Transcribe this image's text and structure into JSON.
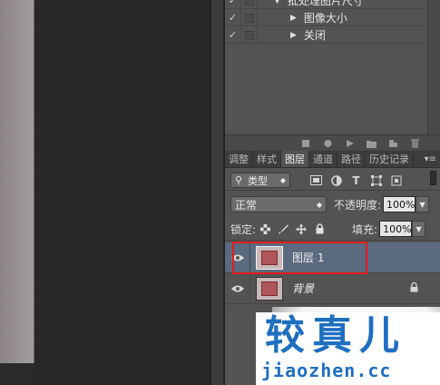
{
  "actions": {
    "items": [
      {
        "label": "批处理图片尺寸",
        "expand": "▼",
        "checked": "✓"
      },
      {
        "label": "图像大小",
        "expand": "▶",
        "checked": "✓"
      },
      {
        "label": "关闭",
        "expand": "▶",
        "checked": "✓"
      }
    ]
  },
  "tabs": {
    "items": [
      "调整",
      "样式",
      "图层",
      "通道",
      "路径",
      "历史记录"
    ],
    "active": "图层",
    "menu_icon": "▾≡"
  },
  "filter": {
    "kind_label": "类型",
    "type_letter": "T"
  },
  "blend": {
    "mode": "正常",
    "opacity_label": "不透明度:",
    "opacity_value": "100%",
    "lock_label": "锁定:",
    "fill_label": "填充:",
    "fill_value": "100%"
  },
  "layers": [
    {
      "name": "图层 1",
      "selected": true
    },
    {
      "name": "背景",
      "selected": false,
      "locked": true
    }
  ],
  "watermark": {
    "title": "较真儿",
    "url": "jiaozhen.cc"
  },
  "colors": {
    "selection": "#5b6a7e",
    "highlight_box": "#e21c1c",
    "watermark": "#1f6fc1"
  }
}
